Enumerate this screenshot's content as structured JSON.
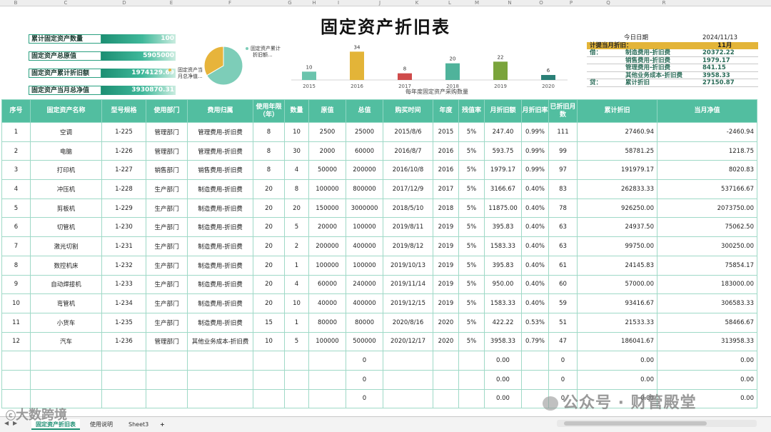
{
  "title": "固定资产折旧表",
  "column_letters": [
    "B",
    "C",
    "D",
    "E",
    "F",
    "G",
    "H",
    "I",
    "J",
    "K",
    "L",
    "M",
    "N",
    "O",
    "P",
    "Q",
    "R"
  ],
  "summary": [
    {
      "label": "累计固定资产数量",
      "value": "100"
    },
    {
      "label": "固定资产总原值",
      "value": "5905000"
    },
    {
      "label": "固定资产累计折旧额",
      "value": "1974129.69"
    },
    {
      "label": "固定资产当月总净值",
      "value": "3930870.31"
    }
  ],
  "pie": {
    "labels": [
      "固定资产累计折旧额...",
      "固定资产当月总净值..."
    ],
    "label_lines": [
      [
        "固定资产累计",
        "折旧额..."
      ],
      [
        "固定资产当",
        "月总净值..."
      ]
    ],
    "values": [
      1974129.69,
      3930870.31
    ],
    "colors": [
      "#e7b43b",
      "#7dcdb8"
    ]
  },
  "chart_data": {
    "type": "bar",
    "title": "每年度固定资产采购数量",
    "categories": [
      "2015",
      "2016",
      "2017",
      "2018",
      "2019",
      "2020"
    ],
    "values": [
      10,
      34,
      8,
      20,
      22,
      6
    ],
    "colors": [
      "#6bc4ad",
      "#e3b438",
      "#cf4b4b",
      "#4fb39b",
      "#7aa43b",
      "#2a8077"
    ],
    "ylim": [
      0,
      36
    ]
  },
  "right_panel": {
    "today_label": "今日日期",
    "today_value": "2024/11/13",
    "month_label": "计提当月折旧：",
    "month_value": "11月",
    "debit_label": "借：",
    "credit_label": "贷：",
    "entries": [
      {
        "side": "借：",
        "cat": "制造费用-折旧费",
        "amt": "20372.22"
      },
      {
        "side": "",
        "cat": "销售费用-折旧费",
        "amt": "1979.17"
      },
      {
        "side": "",
        "cat": "管理费用-折旧费",
        "amt": "841.15"
      },
      {
        "side": "",
        "cat": "其他业务成本-折旧费",
        "amt": "3958.33"
      },
      {
        "side": "贷：",
        "cat": "累计折旧",
        "amt": "27150.87"
      }
    ]
  },
  "table": {
    "headers": [
      "序号",
      "固定资产名称",
      "型号规格",
      "使用部门",
      "费用归属",
      "使用年限（年）",
      "数量",
      "原值",
      "总值",
      "购买时间",
      "年度",
      "残值率",
      "月折旧额",
      "月折旧率",
      "已折旧月数",
      "累计折旧",
      "当月净值"
    ],
    "rows": [
      [
        "1",
        "空调",
        "1-225",
        "管理部门",
        "管理费用-折旧费",
        "8",
        "10",
        "2500",
        "25000",
        "2015/8/6",
        "2015",
        "5%",
        "247.40",
        "0.99%",
        "111",
        "27460.94",
        "-2460.94"
      ],
      [
        "2",
        "电脑",
        "1-226",
        "管理部门",
        "管理费用-折旧费",
        "8",
        "30",
        "2000",
        "60000",
        "2016/8/7",
        "2016",
        "5%",
        "593.75",
        "0.99%",
        "99",
        "58781.25",
        "1218.75"
      ],
      [
        "3",
        "打印机",
        "1-227",
        "销售部门",
        "销售费用-折旧费",
        "8",
        "4",
        "50000",
        "200000",
        "2016/10/8",
        "2016",
        "5%",
        "1979.17",
        "0.99%",
        "97",
        "191979.17",
        "8020.83"
      ],
      [
        "4",
        "冲压机",
        "1-228",
        "生产部门",
        "制造费用-折旧费",
        "20",
        "8",
        "100000",
        "800000",
        "2017/12/9",
        "2017",
        "5%",
        "3166.67",
        "0.40%",
        "83",
        "262833.33",
        "537166.67"
      ],
      [
        "5",
        "剪板机",
        "1-229",
        "生产部门",
        "制造费用-折旧费",
        "20",
        "20",
        "150000",
        "3000000",
        "2018/5/10",
        "2018",
        "5%",
        "11875.00",
        "0.40%",
        "78",
        "926250.00",
        "2073750.00"
      ],
      [
        "6",
        "切管机",
        "1-230",
        "生产部门",
        "制造费用-折旧费",
        "20",
        "5",
        "20000",
        "100000",
        "2019/8/11",
        "2019",
        "5%",
        "395.83",
        "0.40%",
        "63",
        "24937.50",
        "75062.50"
      ],
      [
        "7",
        "激光切割",
        "1-231",
        "生产部门",
        "制造费用-折旧费",
        "20",
        "2",
        "200000",
        "400000",
        "2019/8/12",
        "2019",
        "5%",
        "1583.33",
        "0.40%",
        "63",
        "99750.00",
        "300250.00"
      ],
      [
        "8",
        "数控机床",
        "1-232",
        "生产部门",
        "制造费用-折旧费",
        "20",
        "1",
        "100000",
        "100000",
        "2019/10/13",
        "2019",
        "5%",
        "395.83",
        "0.40%",
        "61",
        "24145.83",
        "75854.17"
      ],
      [
        "9",
        "自动焊接机",
        "1-233",
        "生产部门",
        "制造费用-折旧费",
        "20",
        "4",
        "60000",
        "240000",
        "2019/11/14",
        "2019",
        "5%",
        "950.00",
        "0.40%",
        "60",
        "57000.00",
        "183000.00"
      ],
      [
        "10",
        "弯管机",
        "1-234",
        "生产部门",
        "制造费用-折旧费",
        "20",
        "10",
        "40000",
        "400000",
        "2019/12/15",
        "2019",
        "5%",
        "1583.33",
        "0.40%",
        "59",
        "93416.67",
        "306583.33"
      ],
      [
        "11",
        "小货车",
        "1-235",
        "生产部门",
        "制造费用-折旧费",
        "15",
        "1",
        "80000",
        "80000",
        "2020/8/16",
        "2020",
        "5%",
        "422.22",
        "0.53%",
        "51",
        "21533.33",
        "58466.67"
      ],
      [
        "12",
        "汽车",
        "1-236",
        "管理部门",
        "其他业务成本-折旧费",
        "10",
        "5",
        "100000",
        "500000",
        "2020/12/17",
        "2020",
        "5%",
        "3958.33",
        "0.79%",
        "47",
        "186041.67",
        "313958.33"
      ],
      [
        "",
        "",
        "",
        "",
        "",
        "",
        "",
        "",
        "0",
        "",
        "",
        "",
        "0.00",
        "",
        "0",
        "0.00",
        "0.00"
      ],
      [
        "",
        "",
        "",
        "",
        "",
        "",
        "",
        "",
        "0",
        "",
        "",
        "",
        "0.00",
        "",
        "0",
        "0.00",
        "0.00"
      ],
      [
        "",
        "",
        "",
        "",
        "",
        "",
        "",
        "",
        "0",
        "",
        "",
        "",
        "0.00",
        "",
        "0",
        "0.00",
        "0.00"
      ]
    ]
  },
  "sheet_tabs": [
    "固定资产折旧表",
    "使用说明",
    "Sheet3"
  ],
  "add_sheet": "+",
  "watermark_left": "大数跨境",
  "watermark_right": "公众号 · 财管殿堂"
}
